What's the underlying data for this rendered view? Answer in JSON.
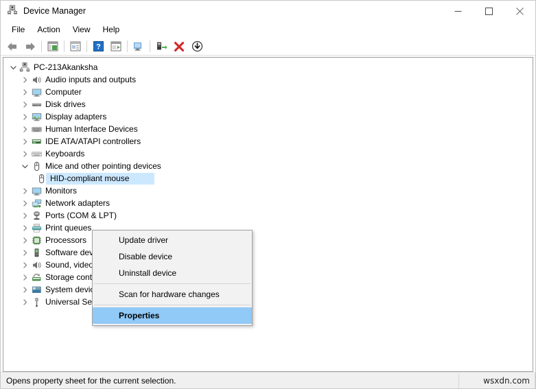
{
  "window": {
    "title": "Device Manager",
    "icon": "device-manager-icon",
    "controls": {
      "minimize": "minimize-icon",
      "maximize": "maximize-icon",
      "close": "close-icon"
    }
  },
  "menubar": {
    "items": [
      {
        "label": "File"
      },
      {
        "label": "Action"
      },
      {
        "label": "View"
      },
      {
        "label": "Help"
      }
    ]
  },
  "toolbar": {
    "buttons": [
      {
        "name": "back-icon"
      },
      {
        "name": "forward-icon"
      },
      {
        "name": "show-hide-console-tree-icon"
      },
      {
        "name": "properties-icon"
      },
      {
        "name": "help-icon"
      },
      {
        "name": "show-hide-action-pane-icon"
      },
      {
        "name": "scan-for-hardware-changes-icon"
      },
      {
        "name": "update-driver-icon"
      },
      {
        "name": "uninstall-device-icon"
      },
      {
        "name": "disable-device-icon"
      }
    ]
  },
  "tree": {
    "root": {
      "label": "PC-213Akanksha",
      "icon": "computer-root-icon",
      "expanded": true
    },
    "items": [
      {
        "label": "Audio inputs and outputs",
        "icon": "speaker-icon",
        "expanded": false,
        "level": 1
      },
      {
        "label": "Computer",
        "icon": "monitor-icon",
        "expanded": false,
        "level": 1
      },
      {
        "label": "Disk drives",
        "icon": "disk-drive-icon",
        "expanded": false,
        "level": 1
      },
      {
        "label": "Display adapters",
        "icon": "display-adapter-icon",
        "expanded": false,
        "level": 1
      },
      {
        "label": "Human Interface Devices",
        "icon": "hid-keyboard-icon",
        "expanded": false,
        "level": 1
      },
      {
        "label": "IDE ATA/ATAPI controllers",
        "icon": "ide-controller-icon",
        "expanded": false,
        "level": 1
      },
      {
        "label": "Keyboards",
        "icon": "keyboard-icon",
        "expanded": false,
        "level": 1
      },
      {
        "label": "Mice and other pointing devices",
        "icon": "mouse-icon",
        "expanded": true,
        "level": 1
      },
      {
        "label": "HID-compliant mouse",
        "icon": "mouse-icon",
        "expanded": null,
        "level": 2,
        "selected": true
      },
      {
        "label": "Monitors",
        "icon": "monitor-icon",
        "expanded": false,
        "level": 1
      },
      {
        "label": "Network adapters",
        "icon": "network-adapter-icon",
        "expanded": false,
        "level": 1
      },
      {
        "label": "Ports (COM & LPT)",
        "icon": "port-icon",
        "expanded": false,
        "level": 1
      },
      {
        "label": "Print queues",
        "icon": "printer-icon",
        "expanded": false,
        "level": 1
      },
      {
        "label": "Processors",
        "icon": "processor-icon",
        "expanded": false,
        "level": 1
      },
      {
        "label": "Software devices",
        "icon": "software-device-icon",
        "expanded": false,
        "level": 1
      },
      {
        "label": "Sound, video and game controllers",
        "icon": "sound-icon",
        "expanded": false,
        "level": 1
      },
      {
        "label": "Storage controllers",
        "icon": "storage-controller-icon",
        "expanded": false,
        "level": 1
      },
      {
        "label": "System devices",
        "icon": "system-device-icon",
        "expanded": false,
        "level": 1
      },
      {
        "label": "Universal Serial Bus controllers",
        "icon": "usb-icon",
        "expanded": false,
        "level": 1
      }
    ]
  },
  "context_menu": {
    "items": [
      {
        "label": "Update driver",
        "type": "item",
        "highlight": false
      },
      {
        "label": "Disable device",
        "type": "item",
        "highlight": false
      },
      {
        "label": "Uninstall device",
        "type": "item",
        "highlight": false
      },
      {
        "label": "",
        "type": "separator"
      },
      {
        "label": "Scan for hardware changes",
        "type": "item",
        "highlight": false
      },
      {
        "label": "",
        "type": "separator"
      },
      {
        "label": "Properties",
        "type": "item",
        "highlight": true
      }
    ]
  },
  "statusbar": {
    "text": "Opens property sheet for the current selection.",
    "watermark": "wsxdn.com"
  },
  "colors": {
    "selection_blue": "#cce8ff",
    "menu_highlight": "#91c9f7",
    "menu_bg": "#f2f2f2",
    "status_bg": "#f0f0f0",
    "close_red": "#e81123"
  }
}
